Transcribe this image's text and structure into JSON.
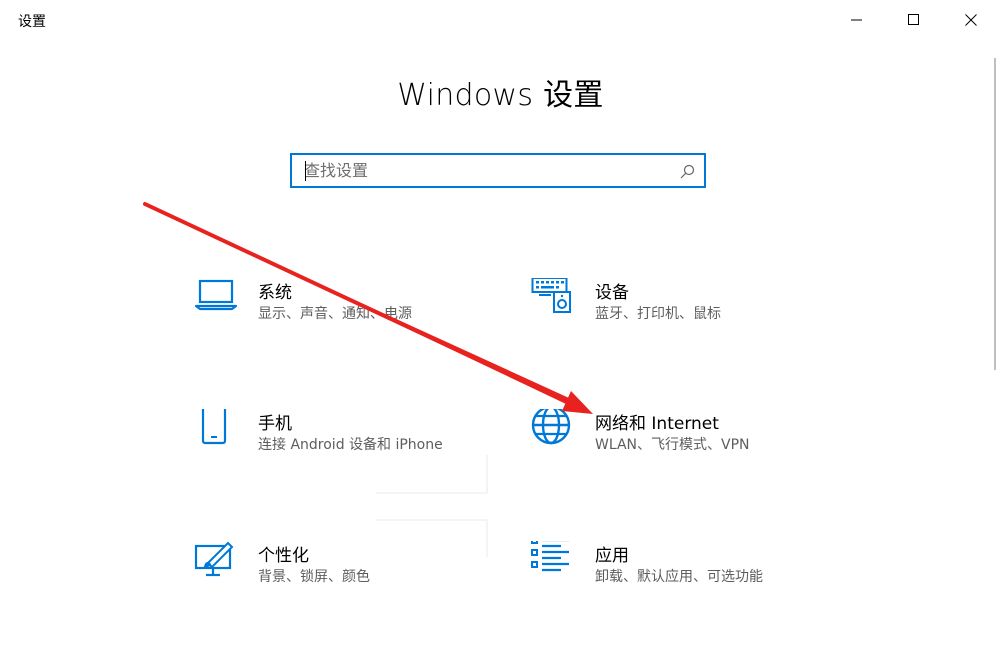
{
  "window": {
    "title": "设置",
    "controls": {
      "minimize": "minimize-icon",
      "maximize": "maximize-icon",
      "close": "close-icon"
    }
  },
  "header": {
    "title": "Windows 设置"
  },
  "search": {
    "placeholder": "查找设置",
    "value": ""
  },
  "tiles": [
    {
      "icon": "laptop-icon",
      "title": "系统",
      "desc": "显示、声音、通知、电源"
    },
    {
      "icon": "keyboard-speaker-icon",
      "title": "设备",
      "desc": "蓝牙、打印机、鼠标"
    },
    {
      "icon": "phone-icon",
      "title": "手机",
      "desc": "连接 Android 设备和 iPhone"
    },
    {
      "icon": "globe-icon",
      "title": "网络和 Internet",
      "desc": "WLAN、飞行模式、VPN"
    },
    {
      "icon": "paint-easel-icon",
      "title": "个性化",
      "desc": "背景、锁屏、颜色"
    },
    {
      "icon": "app-list-icon",
      "title": "应用",
      "desc": "卸载、默认应用、可选功能"
    }
  ],
  "colors": {
    "accent": "#0078d7",
    "annotation_arrow": "#e8231f"
  }
}
